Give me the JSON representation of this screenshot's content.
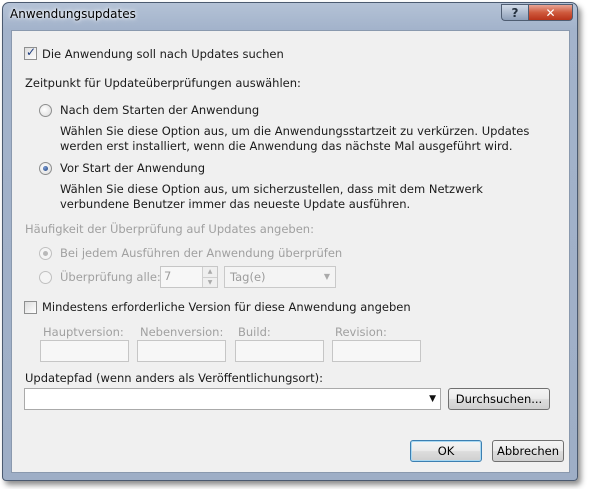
{
  "window": {
    "title": "Anwendungsupdates",
    "help_button_label": "?",
    "close_button_label": "✕"
  },
  "check_updates": {
    "label": "Die Anwendung soll nach Updates suchen",
    "checked": true
  },
  "timing": {
    "heading": "Zeitpunkt für Updateüberprüfungen auswählen:",
    "after_start": {
      "label": "Nach dem Starten der Anwendung",
      "description": "Wählen Sie diese Option aus, um die Anwendungsstartzeit zu verkürzen. Updates werden erst installiert, wenn die Anwendung das nächste Mal ausgeführt wird.",
      "selected": false
    },
    "before_start": {
      "label": "Vor Start der Anwendung",
      "description": "Wählen Sie diese Option aus, um sicherzustellen, dass mit dem Netzwerk verbundene Benutzer immer das neueste Update ausführen.",
      "selected": true
    }
  },
  "frequency": {
    "heading": "Häufigkeit der Überprüfung auf Updates angeben:",
    "every_run": {
      "label": "Bei jedem Ausführen der Anwendung überprüfen",
      "selected": true
    },
    "every": {
      "label": "Überprüfung alle:",
      "value": "7",
      "unit": "Tag(e)",
      "selected": false
    }
  },
  "min_version": {
    "label": "Mindestens erforderliche Version für diese Anwendung angeben",
    "checked": false,
    "fields": {
      "major": "Hauptversion:",
      "minor": "Nebenversion:",
      "build": "Build:",
      "revision": "Revision:"
    }
  },
  "update_path": {
    "label": "Updatepfad (wenn anders als Veröffentlichungsort):",
    "value": "",
    "browse_label": "Durchsuchen..."
  },
  "buttons": {
    "ok": "OK",
    "cancel": "Abbrechen"
  },
  "colors": {
    "title_bar": "#a3b3cb",
    "close_button": "#c8432a",
    "dialog_bg": "#f0f0f0",
    "disabled_text": "#a0a0a0"
  }
}
